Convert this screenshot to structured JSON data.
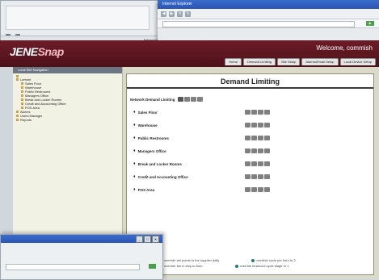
{
  "back_window": {
    "status_text": "Internet",
    "buttons": [
      "",
      ""
    ]
  },
  "browser": {
    "title": "Internet Explorer",
    "toolbar_icons": [
      "back-icon",
      "forward-icon",
      "stop-icon",
      "refresh-icon"
    ]
  },
  "header": {
    "logo_main": "JENE",
    "logo_accent": "Snap",
    "logo_sub": "",
    "welcome": "Welcome, commish",
    "welcome_sub": "",
    "tabs": [
      "Home",
      "Demand Limiting",
      "Site Setup",
      "Alarms/Email Setup",
      "Local Device Setup"
    ]
  },
  "sidebar": {
    "title": "Local Site Navigation",
    "items": [
      {
        "label": "",
        "level": 0,
        "selected": true
      },
      {
        "label": "Lamont",
        "level": 0
      },
      {
        "label": "Sales Floor",
        "level": 1
      },
      {
        "label": "Warehouse",
        "level": 1
      },
      {
        "label": "Public Restrooms",
        "level": 1
      },
      {
        "label": "Managers Office",
        "level": 1
      },
      {
        "label": "Break and Locker Rooms",
        "level": 1
      },
      {
        "label": "Credit and Accounting Office",
        "level": 1
      },
      {
        "label": "POS Area",
        "level": 1
      },
      {
        "label": "Alarms",
        "level": 0
      },
      {
        "label": "Users Manager",
        "level": 0
      },
      {
        "label": "Reports",
        "level": 0
      }
    ]
  },
  "main": {
    "title": "Demand Limiting",
    "network_label": "Network Demand Limiting",
    "locations": [
      "Sales Floor",
      "Warehouse",
      "Public Restrooms",
      "Managers Office",
      "Break and Locker Rooms",
      "Credit and Accounting Office",
      "POS Area"
    ],
    "legend": [
      "override set points to the supplier daily",
      "override cycle per hour to 2",
      "override fan in stop to Auto",
      "override heat/cool cycle stage to 1"
    ]
  }
}
